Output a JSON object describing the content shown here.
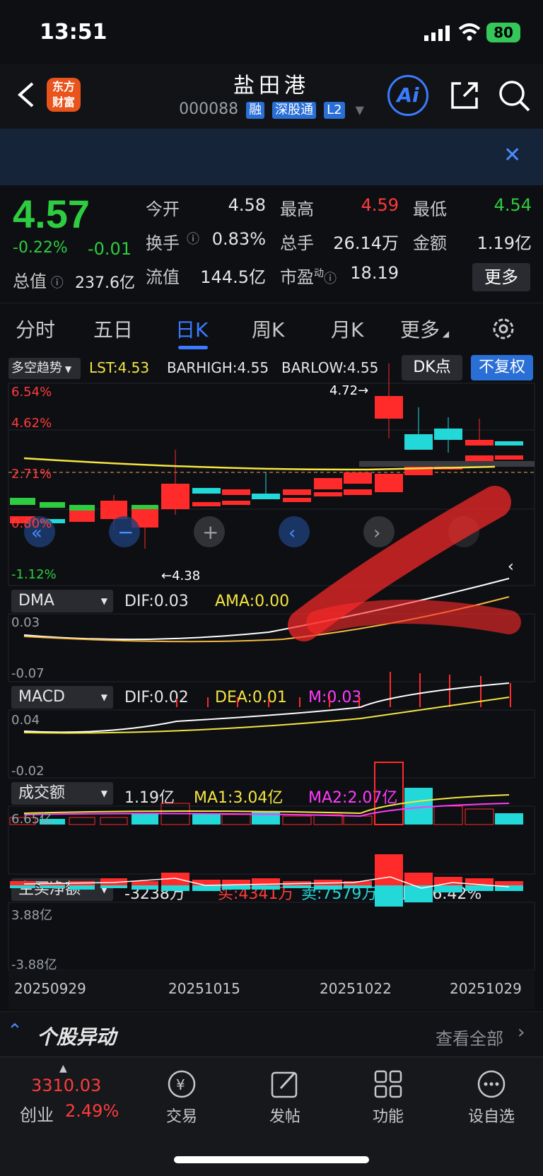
{
  "status": {
    "time": "13:51",
    "battery": "80"
  },
  "header": {
    "logo_text_1": "东方",
    "logo_text_2": "财富",
    "name": "盐田港",
    "code": "000088",
    "tags": [
      "融",
      "深股通",
      "L2"
    ],
    "ai_label": "Ai"
  },
  "quote": {
    "price": "4.57",
    "change_pct": "-0.22%",
    "change_abs": "-0.01",
    "total_value_label": "总值",
    "total_value": "237.6亿",
    "open_label": "今开",
    "open": "4.58",
    "high_label": "最高",
    "high": "4.59",
    "low_label": "最低",
    "low": "4.54",
    "turnover_label": "换手",
    "turnover": "0.83%",
    "volume_label": "总手",
    "volume": "26.14万",
    "amount_label": "金额",
    "amount": "1.19亿",
    "float_label": "流值",
    "float_value": "144.5亿",
    "pe_label": "市盈",
    "pe_sup": "动",
    "pe": "18.19",
    "more_label": "更多"
  },
  "tabs": [
    "分时",
    "五日",
    "日K",
    "周K",
    "月K",
    "更多"
  ],
  "main_chart": {
    "indicator": "多空趋势",
    "lst": "LST:4.53",
    "barhigh": "BARHIGH:4.55",
    "barlow": "BARLOW:4.55",
    "dk_btn": "DK点",
    "fq_btn": "不复权",
    "pct_labels": [
      "6.54%",
      "4.62%",
      "2.71%",
      "0.80%",
      "-1.12%"
    ],
    "high_mark": "4.72",
    "low_mark": "4.38"
  },
  "dma": {
    "name": "DMA",
    "dif": "DIF:0.03",
    "ama": "AMA:0.00",
    "top": "0.03",
    "bottom": "-0.07"
  },
  "macd": {
    "name": "MACD",
    "dif": "DIF:0.02",
    "dea": "DEA:0.01",
    "m": "M:0.03",
    "top": "0.04",
    "bottom": "-0.02"
  },
  "turnover_ind": {
    "name": "成交额",
    "value": "1.19亿",
    "ma1": "MA1:3.04亿",
    "ma2": "MA2:2.07亿",
    "top": "6.65亿"
  },
  "net_buy": {
    "name": "主买净额",
    "value": "-3238万",
    "buy": "买:4341万",
    "sell": "卖:7579万",
    "ratio": "占比:36.42%",
    "top": "3.88亿",
    "bottom": "-3.88亿"
  },
  "dates": [
    "20250929",
    "20251015",
    "20251022",
    "20251029"
  ],
  "anomaly": {
    "title": "个股异动",
    "view_all": "查看全部"
  },
  "tabbar": {
    "index_value": "3310.03",
    "index_name": "创业",
    "index_change": "2.49%",
    "items": [
      "交易",
      "发帖",
      "功能",
      "设自选"
    ]
  },
  "colors": {
    "up": "#ff3b3b",
    "down": "#2ecc40",
    "accent": "#3b7bff",
    "cyan": "#22d8d8",
    "yellow": "#f4e542",
    "magenta": "#ff3bff"
  }
}
